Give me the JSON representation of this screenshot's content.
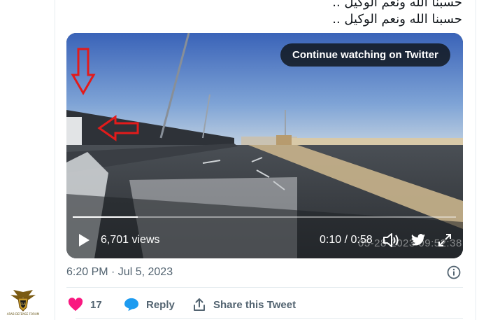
{
  "tweet": {
    "text_lines": [
      "حسبنا الله ونعم الوكيل ..",
      "حسبنا الله ونعم الوكيل .."
    ],
    "timestamp": "6:20 PM · Jul 5, 2023"
  },
  "video": {
    "continue_label": "Continue watching on Twitter",
    "views": "6,701 views",
    "time": "0:10 / 0:58",
    "overlay_date": "05-28-2023 09:52:38",
    "progress": 0.17
  },
  "actions": {
    "likes_count": "17",
    "reply_label": "Reply",
    "share_label": "Share this Tweet"
  },
  "logo": {
    "caption": "ARAB DEFENSE FORUM"
  },
  "colors": {
    "like": "#f91880",
    "reply": "#1d9bf0",
    "annotation_red": "#e21b1b"
  }
}
